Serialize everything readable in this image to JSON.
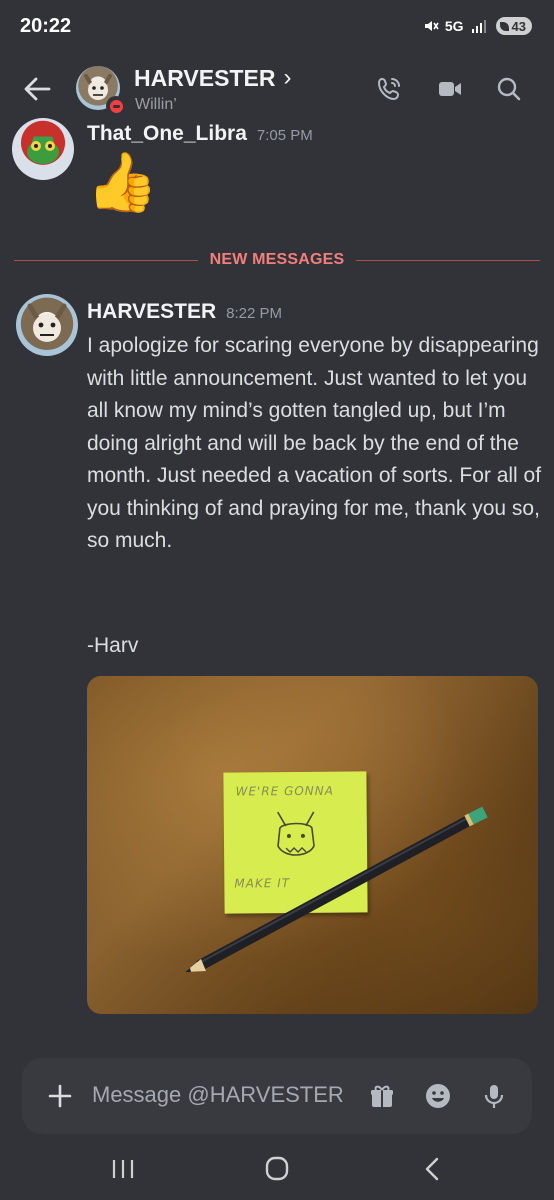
{
  "status_bar": {
    "time": "20:22",
    "network": "5G",
    "battery": "43"
  },
  "header": {
    "name": "HARVESTER",
    "chevron": "›",
    "status": "Willin’",
    "icons": [
      "back-arrow-icon",
      "voice-call-icon",
      "video-call-icon",
      "search-icon"
    ]
  },
  "messages": [
    {
      "author": "That_One_Libra",
      "time": "7:05 PM",
      "content": "👍"
    },
    {
      "author": "HARVESTER",
      "time": "8:22 PM",
      "content": "I apologize for scaring everyone by disappearing with little announcement. Just wanted to let you all know my mind’s gotten tangled up, but I’m doing alright and will be back by the end of the month. Just needed a vacation of sorts. For all of you thinking of and praying for me, thank you so, so much.",
      "signature": "-Harv",
      "attachment": {
        "note_top": "WE'RE GONNA",
        "note_bottom": "MAKE IT"
      }
    }
  ],
  "divider": {
    "label": "NEW MESSAGES",
    "color": "#f27f7c"
  },
  "composer": {
    "placeholder": "Message @HARVESTER",
    "icons": [
      "plus-icon",
      "gift-icon",
      "emoji-icon",
      "microphone-icon"
    ]
  },
  "nav_bar": {
    "icons": [
      "recent-apps-icon",
      "home-icon",
      "back-icon"
    ]
  },
  "colors": {
    "background": "#313338",
    "input": "#383a40",
    "dnd": "#f23f43",
    "text": "#dbdee1"
  }
}
